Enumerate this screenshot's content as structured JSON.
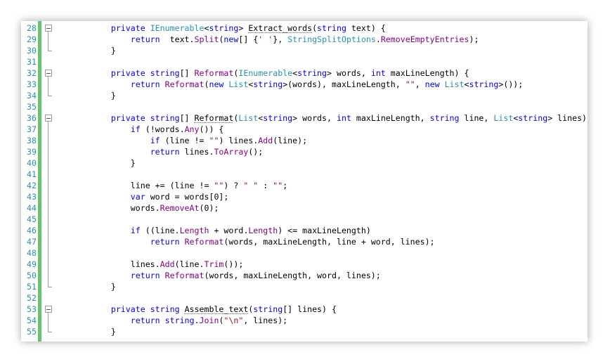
{
  "editor": {
    "accent_change_bar": "#67c16e",
    "colors": {
      "keyword": "#0000ff",
      "type": "#2b91af",
      "string": "#a31515",
      "method": "#880088",
      "line_number": "#2b91af"
    },
    "lines": [
      {
        "n": "28",
        "fold": "start",
        "tokens": [
          [
            "",
            "        "
          ],
          [
            "kw",
            "private "
          ],
          [
            "ty",
            "IEnumerable"
          ],
          [
            "",
            "<"
          ],
          [
            "kw",
            "string"
          ],
          [
            "",
            "> "
          ],
          [
            "sq",
            "Extract_words"
          ],
          [
            "",
            "("
          ],
          [
            "kw",
            "string"
          ],
          [
            "",
            " text) {"
          ]
        ]
      },
      {
        "n": "29",
        "tokens": [
          [
            "",
            "            "
          ],
          [
            "kw",
            "return "
          ],
          [
            "",
            " text."
          ],
          [
            "mt",
            "Split"
          ],
          [
            "",
            "("
          ],
          [
            "kw",
            "new"
          ],
          [
            "",
            "[] {"
          ],
          [
            "st",
            "' '"
          ],
          [
            "",
            "}, "
          ],
          [
            "ty",
            "StringSplitOptions"
          ],
          [
            "",
            "."
          ],
          [
            "mt",
            "RemoveEmptyEntries"
          ],
          [
            "",
            ");"
          ]
        ]
      },
      {
        "n": "30",
        "fold": "end",
        "tokens": [
          [
            "",
            "        }"
          ]
        ]
      },
      {
        "n": "31",
        "tokens": []
      },
      {
        "n": "32",
        "fold": "start",
        "tokens": [
          [
            "",
            "        "
          ],
          [
            "kw",
            "private "
          ],
          [
            "kw",
            "string"
          ],
          [
            "",
            "[] "
          ],
          [
            "mt",
            "Reformat"
          ],
          [
            "",
            "("
          ],
          [
            "ty",
            "IEnumerable"
          ],
          [
            "",
            "<"
          ],
          [
            "kw",
            "string"
          ],
          [
            "",
            "> words, "
          ],
          [
            "kw",
            "int"
          ],
          [
            "",
            " maxLineLength) {"
          ]
        ]
      },
      {
        "n": "33",
        "tokens": [
          [
            "",
            "            "
          ],
          [
            "kw",
            "return "
          ],
          [
            "mt",
            "Reformat"
          ],
          [
            "",
            "("
          ],
          [
            "kw",
            "new "
          ],
          [
            "ty",
            "List"
          ],
          [
            "",
            "<"
          ],
          [
            "kw",
            "string"
          ],
          [
            "",
            ">(words), maxLineLength, "
          ],
          [
            "st",
            "\"\""
          ],
          [
            "",
            ", "
          ],
          [
            "kw",
            "new "
          ],
          [
            "ty",
            "List"
          ],
          [
            "",
            "<"
          ],
          [
            "kw",
            "string"
          ],
          [
            "",
            ">());"
          ]
        ]
      },
      {
        "n": "34",
        "fold": "end",
        "tokens": [
          [
            "",
            "        }"
          ]
        ]
      },
      {
        "n": "35",
        "tokens": []
      },
      {
        "n": "36",
        "fold": "start",
        "tokens": [
          [
            "",
            "        "
          ],
          [
            "kw",
            "private "
          ],
          [
            "kw",
            "string"
          ],
          [
            "",
            "[] "
          ],
          [
            "sq",
            "Reformat"
          ],
          [
            "",
            "("
          ],
          [
            "ty",
            "List"
          ],
          [
            "",
            "<"
          ],
          [
            "kw",
            "string"
          ],
          [
            "",
            "> words, "
          ],
          [
            "kw",
            "int"
          ],
          [
            "",
            " maxLineLength, "
          ],
          [
            "kw",
            "string"
          ],
          [
            "",
            " line, "
          ],
          [
            "ty",
            "List"
          ],
          [
            "",
            "<"
          ],
          [
            "kw",
            "string"
          ],
          [
            "",
            "> lines) {"
          ]
        ]
      },
      {
        "n": "37",
        "tokens": [
          [
            "",
            "            "
          ],
          [
            "kw",
            "if"
          ],
          [
            "",
            " (!words."
          ],
          [
            "mt",
            "Any"
          ],
          [
            "",
            "()) {"
          ]
        ]
      },
      {
        "n": "38",
        "tokens": [
          [
            "",
            "                "
          ],
          [
            "kw",
            "if"
          ],
          [
            "",
            " (line != "
          ],
          [
            "st",
            "\"\""
          ],
          [
            "",
            ") lines."
          ],
          [
            "mt",
            "Add"
          ],
          [
            "",
            "(line);"
          ]
        ]
      },
      {
        "n": "39",
        "tokens": [
          [
            "",
            "                "
          ],
          [
            "kw",
            "return"
          ],
          [
            "",
            " lines."
          ],
          [
            "mt",
            "ToArray"
          ],
          [
            "",
            "();"
          ]
        ]
      },
      {
        "n": "40",
        "tokens": [
          [
            "",
            "            }"
          ]
        ]
      },
      {
        "n": "41",
        "tokens": []
      },
      {
        "n": "42",
        "tokens": [
          [
            "",
            "            line += (line != "
          ],
          [
            "st",
            "\"\""
          ],
          [
            "",
            ") ? "
          ],
          [
            "st",
            "\" \""
          ],
          [
            "",
            " : "
          ],
          [
            "st",
            "\"\""
          ],
          [
            "",
            ";"
          ]
        ]
      },
      {
        "n": "43",
        "tokens": [
          [
            "",
            "            "
          ],
          [
            "kw",
            "var"
          ],
          [
            "",
            " word = words[0];"
          ]
        ]
      },
      {
        "n": "44",
        "tokens": [
          [
            "",
            "            words."
          ],
          [
            "mt",
            "RemoveAt"
          ],
          [
            "",
            "(0);"
          ]
        ]
      },
      {
        "n": "45",
        "tokens": []
      },
      {
        "n": "46",
        "tokens": [
          [
            "",
            "            "
          ],
          [
            "kw",
            "if"
          ],
          [
            "",
            " ((line."
          ],
          [
            "mt",
            "Length"
          ],
          [
            "",
            " + word."
          ],
          [
            "mt",
            "Length"
          ],
          [
            "",
            ") <= maxLineLength)"
          ]
        ]
      },
      {
        "n": "47",
        "tokens": [
          [
            "",
            "                "
          ],
          [
            "kw",
            "return "
          ],
          [
            "mt",
            "Reformat"
          ],
          [
            "",
            "(words, maxLineLength, line + word, lines);"
          ]
        ]
      },
      {
        "n": "48",
        "tokens": []
      },
      {
        "n": "49",
        "tokens": [
          [
            "",
            "            lines."
          ],
          [
            "mt",
            "Add"
          ],
          [
            "",
            "(line."
          ],
          [
            "mt",
            "Trim"
          ],
          [
            "",
            "());"
          ]
        ]
      },
      {
        "n": "50",
        "tokens": [
          [
            "",
            "            "
          ],
          [
            "kw",
            "return "
          ],
          [
            "mt",
            "Reformat"
          ],
          [
            "",
            "(words, maxLineLength, word, lines);"
          ]
        ]
      },
      {
        "n": "51",
        "fold": "end",
        "tokens": [
          [
            "",
            "        }"
          ]
        ]
      },
      {
        "n": "52",
        "tokens": []
      },
      {
        "n": "53",
        "fold": "start",
        "tokens": [
          [
            "",
            "        "
          ],
          [
            "kw",
            "private "
          ],
          [
            "kw",
            "string"
          ],
          [
            "",
            " "
          ],
          [
            "sq",
            "Assemble_text"
          ],
          [
            "",
            "("
          ],
          [
            "kw",
            "string"
          ],
          [
            "",
            "[] lines) {"
          ]
        ]
      },
      {
        "n": "54",
        "tokens": [
          [
            "",
            "            "
          ],
          [
            "kw",
            "return "
          ],
          [
            "kw",
            "string"
          ],
          [
            "",
            "."
          ],
          [
            "mt",
            "Join"
          ],
          [
            "",
            "("
          ],
          [
            "st",
            "\"\\n\""
          ],
          [
            "",
            ", lines);"
          ]
        ]
      },
      {
        "n": "55",
        "fold": "end",
        "tokens": [
          [
            "",
            "        }"
          ]
        ]
      }
    ]
  }
}
